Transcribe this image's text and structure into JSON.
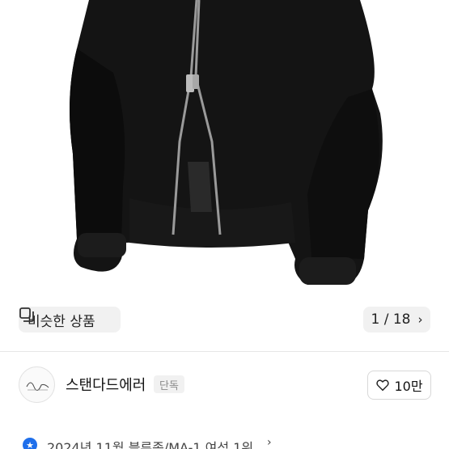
{
  "gallery": {
    "similar_label": "비슷한 상품",
    "counter": "1 / 18",
    "chevron": "›",
    "icons": {
      "similar": "similar-products-icon",
      "next": "chevron-right-icon"
    }
  },
  "shop": {
    "name": "스탠다드에러",
    "badge": "단독",
    "likes": "10만",
    "icons": {
      "like": "heart-icon",
      "avatar": "shop-logo"
    }
  },
  "ranking": {
    "text": "2024년 11월 블루종/MA-1 여성 1위",
    "chevron": "›",
    "icon": "rank-badge-icon"
  },
  "colors": {
    "accent": "#1f6feb",
    "jacket": "#141414",
    "pill_bg": "#f0f0f0"
  }
}
